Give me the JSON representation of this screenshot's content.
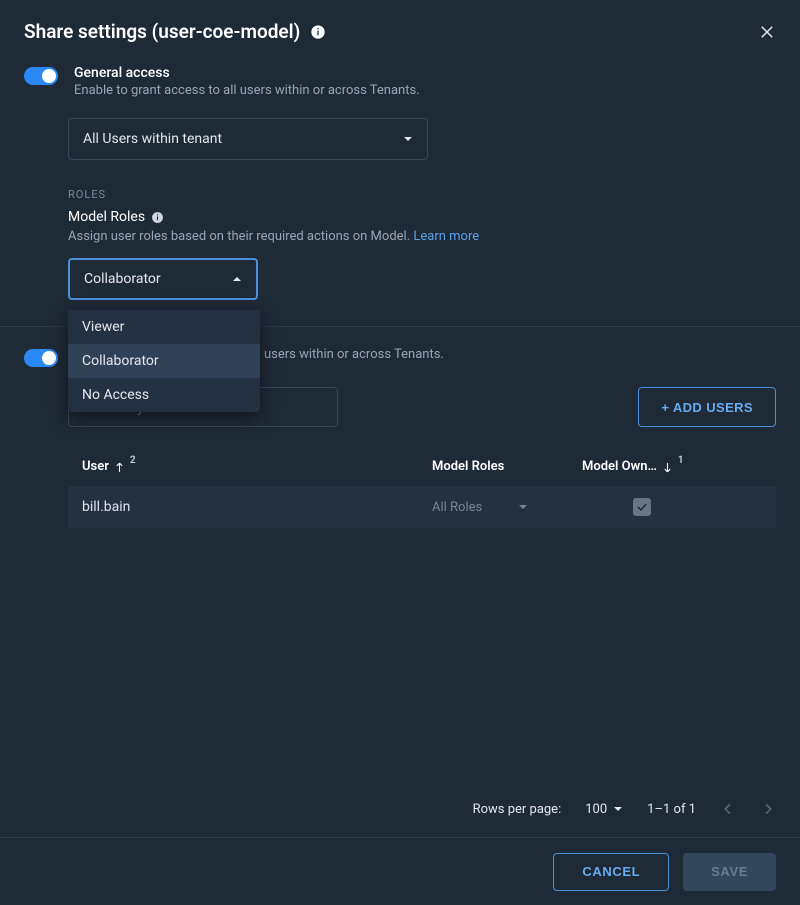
{
  "header": {
    "title": "Share settings (user-coe-model)"
  },
  "general_access": {
    "title": "General access",
    "subtitle": "Enable to grant access to all users within or across Tenants.",
    "scope_selected": "All Users within tenant"
  },
  "roles": {
    "section_label": "ROLES",
    "heading": "Model Roles",
    "assign_text": "Assign user roles based on their required actions on Model. ",
    "learn_more": "Learn more",
    "selected_role": "Collaborator",
    "options": [
      "Viewer",
      "Collaborator",
      "No Access"
    ]
  },
  "individual_access": {
    "subtitle_partial": "users within or across Tenants.",
    "search_placeholder": "Search by Username",
    "add_users_label": "+ ADD USERS"
  },
  "table": {
    "columns": {
      "user": "User",
      "user_sort_order": "2",
      "roles": "Model Roles",
      "owner": "Model Own…",
      "owner_sort_order": "1"
    },
    "rows": [
      {
        "user": "bill.bain",
        "role": "All Roles",
        "owner": true
      }
    ]
  },
  "pager": {
    "rows_per_page_label": "Rows per page:",
    "rows_per_page_value": "100",
    "range": "1–1 of 1"
  },
  "footer": {
    "cancel": "CANCEL",
    "save": "SAVE"
  }
}
